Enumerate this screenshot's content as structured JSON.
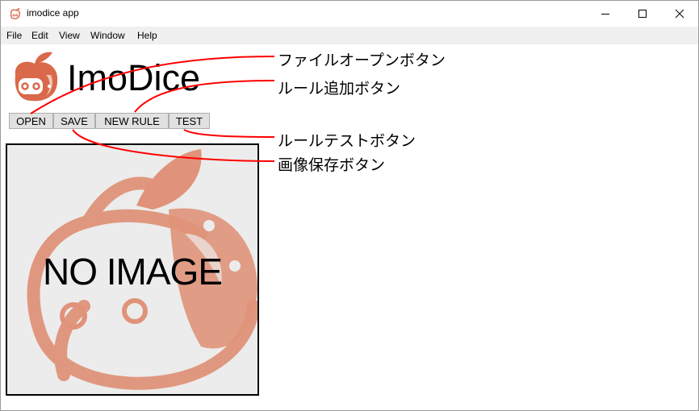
{
  "window": {
    "title": "imodice app",
    "minimize_symbol": "—",
    "maximize_symbol": "□",
    "close_symbol": "✕"
  },
  "menu": [
    "File",
    "Edit",
    "View",
    "Window",
    "Help"
  ],
  "logo": {
    "text": "ImoDice"
  },
  "toolbar": {
    "open_label": "OPEN",
    "save_label": "SAVE",
    "new_rule_label": "NEW RULE",
    "test_label": "TEST"
  },
  "canvas": {
    "placeholder_text": "NO IMAGE"
  },
  "annotations": {
    "open": "ファイルオープンボタン",
    "new_rule": "ルール追加ボタン",
    "test": "ルールテストボタン",
    "save": "画像保存ボタン"
  },
  "colors": {
    "accent": "#d9694a",
    "annotation_line": "#ff0000",
    "button_bg": "#e1e1e1",
    "canvas_bg": "#ececec"
  }
}
